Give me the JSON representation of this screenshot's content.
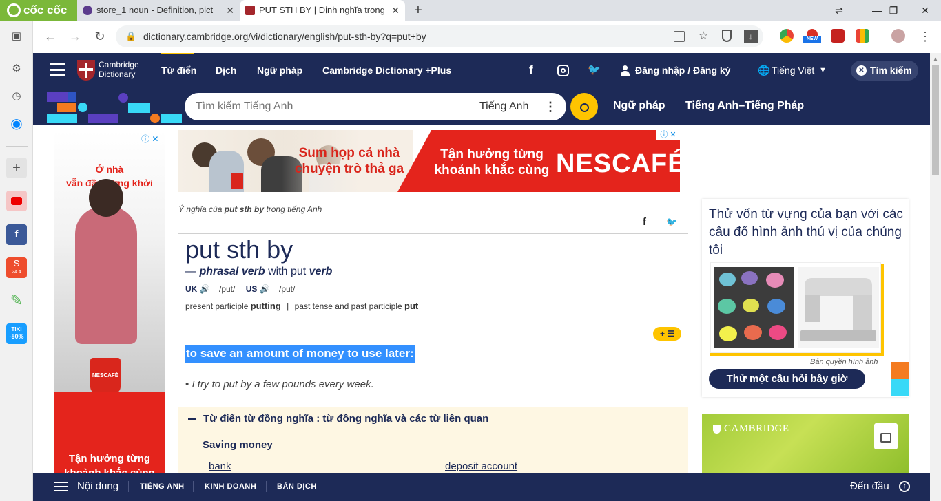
{
  "browser": {
    "logo_text": "cốc cốc",
    "tabs": [
      {
        "title": "store_1 noun - Definition, pict"
      },
      {
        "title": "PUT STH BY | Định nghĩa trong"
      }
    ],
    "new_tab_symbol": "+",
    "url": "dictionary.cambridge.org/vi/dictionary/english/put-sth-by?q=put+by",
    "new_badge": "NEW"
  },
  "sidebar_badges": {
    "shopee": "24.4",
    "tiki": "TIKI",
    "tiki_sale": "-50%"
  },
  "header": {
    "logo_line1": "Cambridge",
    "logo_line2": "Dictionary",
    "nav": [
      "Từ điển",
      "Dịch",
      "Ngữ pháp",
      "Cambridge Dictionary +Plus"
    ],
    "login": "Đăng nhập / Đăng ký",
    "language": "Tiếng Việt",
    "search_button": "Tìm kiếm"
  },
  "search": {
    "placeholder": "Tìm kiếm Tiếng Anh",
    "dictionary": "Tiếng Anh",
    "links": [
      "Ngữ pháp",
      "Tiếng Anh–Tiếng Pháp"
    ]
  },
  "ad_left": {
    "top_text": "Ở nhà\nvẫn đầy hứng khởi",
    "bottom_text": "Tận hưởng từng\nkhoảnh khắc cùng",
    "mug_brand": "NESCAFÉ"
  },
  "ad_banner": {
    "text1": "Sum họp cả nhà\nchuyện trò thả ga",
    "text2": "Tận hưởng từng\nkhoảnh khắc cùng",
    "brand": "NESCAFÉ."
  },
  "entry": {
    "meaning_prefix": "Ý nghĩa của",
    "meaning_word": "put sth by",
    "meaning_suffix": "trong tiếng Anh",
    "headword": "put sth by",
    "pos_dash": "—",
    "pos": "phrasal verb",
    "pos_with": "with put",
    "pos_verb": "verb",
    "uk_label": "UK",
    "uk_pron": "/put/",
    "us_label": "US",
    "us_pron": "/put/",
    "pp_label": "present participle",
    "pp_value": "putting",
    "pt_label": "past tense and past participle",
    "pt_value": "put",
    "definition": "to save an amount of money to use later:",
    "example": "I try to put by a few pounds every week.",
    "thesaurus_title": "Từ điển từ đồng nghĩa : từ đồng nghĩa và các từ liên quan",
    "thesaurus_topic": "Saving money",
    "thesaurus_words": [
      "bank",
      "deposit account"
    ]
  },
  "quiz": {
    "text": "Thử vốn từ vựng của bạn với các câu đố hình ảnh thú vị của chúng tôi",
    "credit": "Bản quyền hình ảnh",
    "button": "Thử một câu hỏi bây giờ"
  },
  "cambridge_ad": {
    "label": "CAMBRIDGE"
  },
  "bottombar": {
    "contents": "Nội dung",
    "tabs": [
      "TIẾNG ANH",
      "KINH DOANH",
      "BẢN DỊCH"
    ],
    "to_top": "Đến đầu"
  }
}
